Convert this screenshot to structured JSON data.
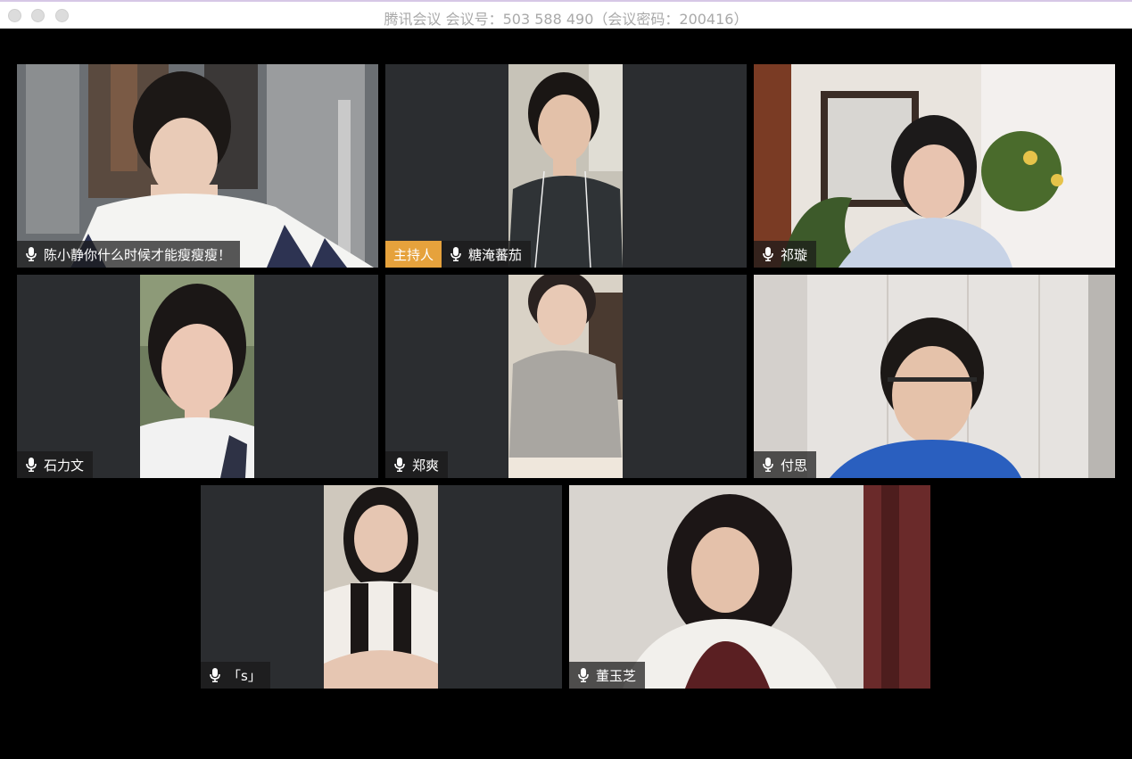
{
  "window": {
    "title": "腾讯会议 会议号：503 588 490（会议密码：200416）"
  },
  "host_badge": "主持人",
  "participants": [
    {
      "name": "陈小静你什么时候才能瘦瘦瘦！",
      "is_host": false
    },
    {
      "name": "糖淹蕃茄",
      "is_host": true
    },
    {
      "name": "祁璇",
      "is_host": false
    },
    {
      "name": "石力文",
      "is_host": false
    },
    {
      "name": "郑爽",
      "is_host": false
    },
    {
      "name": "付思",
      "is_host": false
    },
    {
      "name": "「s」",
      "is_host": false
    },
    {
      "name": "董玉芝",
      "is_host": false
    }
  ],
  "colors": {
    "background": "#000000",
    "tile_background": "#2b2d30",
    "host_badge": "#e6a23c"
  },
  "icons": [
    "microphone-icon"
  ]
}
